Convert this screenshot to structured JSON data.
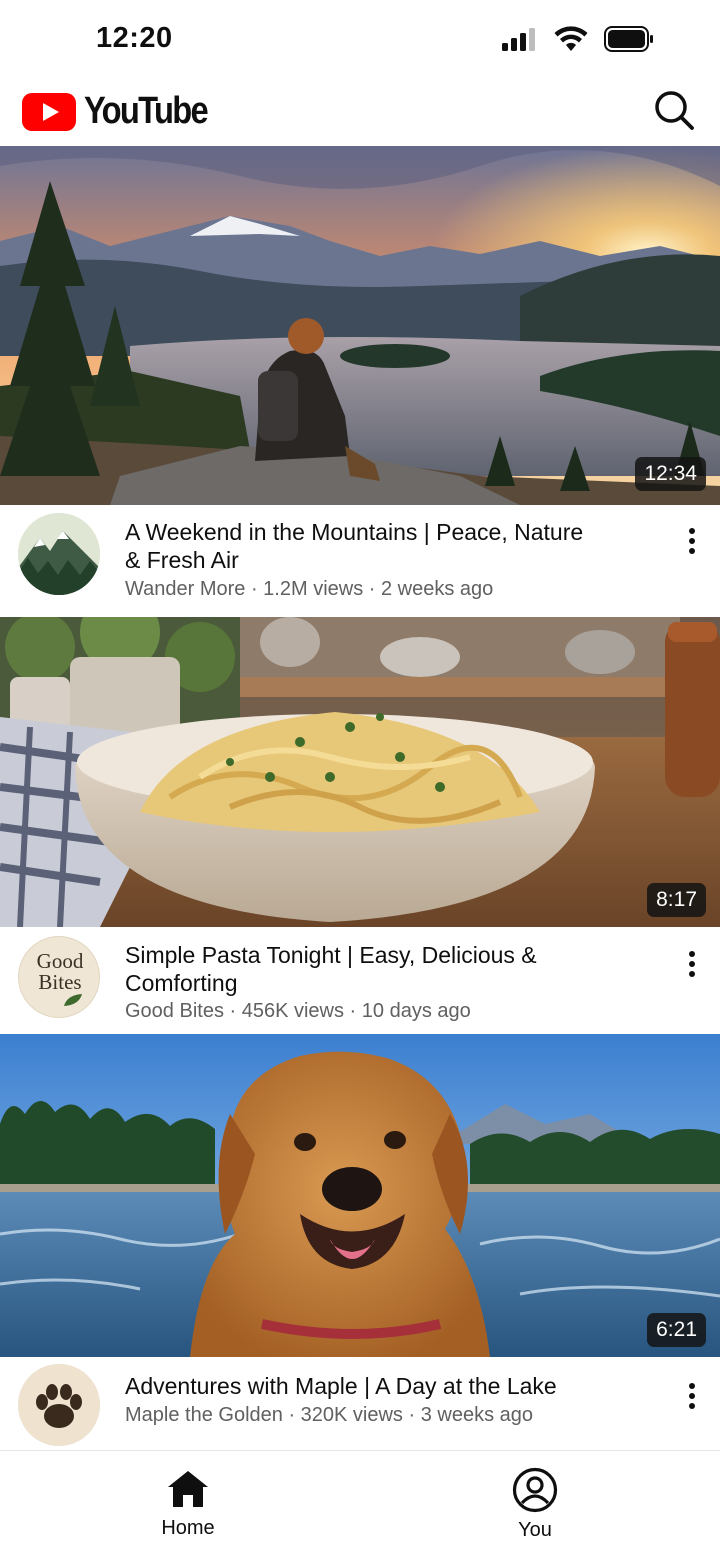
{
  "status_bar": {
    "time": "12:20",
    "icons": [
      "cellular-signal-icon",
      "wifi-icon",
      "battery-icon"
    ]
  },
  "header": {
    "brand": "YouTube",
    "icons": [
      "youtube-play-icon",
      "search-icon"
    ]
  },
  "videos": [
    {
      "title": "A Weekend in the Mountains | Peace, Nature & Fresh Air",
      "channel": "Wander More",
      "meta": "Wander More · 1.2M views · 2 weeks ago",
      "duration": "12:34",
      "thumbnail": "mountain-lake-sunset-hiker"
    },
    {
      "title": "Simple Pasta Tonight | Easy, Delicious & Comforting",
      "channel": "Good Bites",
      "meta": "Good Bites · 456K views · 10 days ago",
      "duration": "8:17",
      "thumbnail": "pasta-bowl-kitchen",
      "avatar_text_1": "Good",
      "avatar_text_2": "Bites"
    },
    {
      "title": "Adventures with Maple | A Day at the Lake",
      "channel": "Maple the Golden",
      "meta": "Maple the Golden · 320K views · 3 weeks ago",
      "duration": "6:21",
      "thumbnail": "golden-retriever-lake"
    }
  ],
  "bottom_nav": {
    "home_label": "Home",
    "you_label": "You",
    "icons": [
      "home-icon",
      "account-icon"
    ]
  },
  "colors": {
    "brand_red": "#ff0000",
    "text_primary": "#0f0f0f",
    "text_secondary": "#606060"
  }
}
